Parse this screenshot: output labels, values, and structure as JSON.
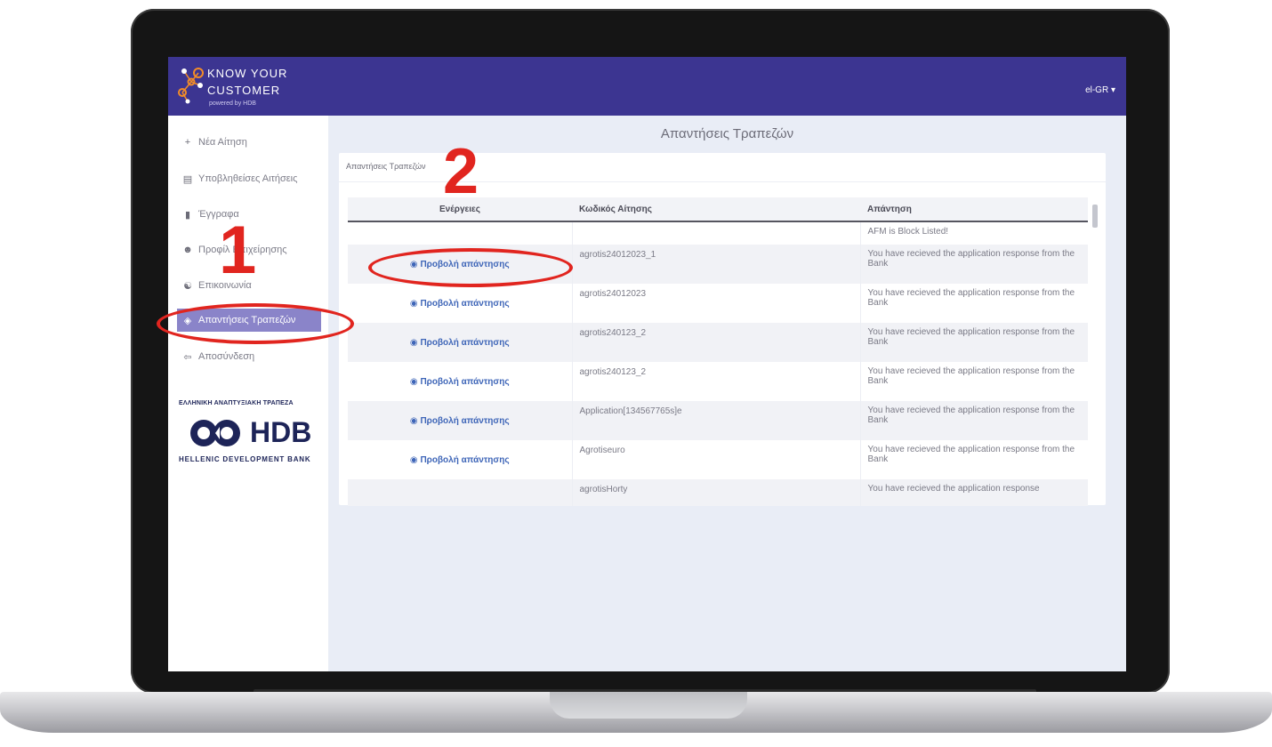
{
  "app": {
    "brand_line1": "KNOW YOUR",
    "brand_line2": "CUSTOMER",
    "brand_sub": "powered by HDB",
    "language": "el-GR",
    "language_icon": "chevron-down-icon"
  },
  "sidebar": {
    "items": [
      {
        "label": "Νέα Αίτηση",
        "icon": "add-user-icon"
      },
      {
        "label": "Υποβληθείσες Αιτήσεις",
        "icon": "document-list-icon"
      },
      {
        "label": "Έγγραφα",
        "icon": "file-icon"
      },
      {
        "label": "Προφίλ Επιχείρησης",
        "icon": "person-icon"
      },
      {
        "label": "Επικοινωνία",
        "icon": "people-icon"
      },
      {
        "label": "Απαντήσεις Τραπεζών",
        "icon": "bell-icon",
        "active": true
      },
      {
        "label": "Αποσύνδεση",
        "icon": "logout-icon"
      }
    ],
    "bank_logo": {
      "greek_name": "ΕΛΛΗΝΙΚΗ ΑΝΑΠΤΥΞΙΑΚΗ ΤΡΑΠΕΖΑ",
      "wordmark": "HDB",
      "english_name": "HELLENIC DEVELOPMENT BANK"
    }
  },
  "main": {
    "title": "Απαντήσεις Τραπεζών",
    "breadcrumb": "Απαντήσεις Τραπεζών",
    "table": {
      "headers": [
        "Ενέργειες",
        "Κωδικός Αίτησης",
        "Απάντηση"
      ],
      "rows": [
        {
          "action": "",
          "code": "",
          "response": "AFM is Block Listed!"
        },
        {
          "action": "Προβολή απάντησης",
          "code": "agrotis24012023_1",
          "response": "You have recieved the application response from the Bank"
        },
        {
          "action": "Προβολή απάντησης",
          "code": "agrotis24012023",
          "response": "You have recieved the application response from the Bank"
        },
        {
          "action": "Προβολή απάντησης",
          "code": "agrotis240123_2",
          "response": "You have recieved the application response from the Bank"
        },
        {
          "action": "Προβολή απάντησης",
          "code": "agrotis240123_2",
          "response": "You have recieved the application response from the Bank"
        },
        {
          "action": "Προβολή απάντησης",
          "code": "Application[134567765s]e",
          "response": "You have recieved the application response from the Bank"
        },
        {
          "action": "Προβολή απάντησης",
          "code": "Agrotiseuro",
          "response": "You have recieved the application response from the Bank"
        },
        {
          "action": "",
          "code": "agrotisHorty",
          "response": "You have recieved the application response"
        }
      ]
    }
  },
  "annotations": {
    "step1": "1",
    "step2": "2",
    "color": "#e1251f"
  },
  "colors": {
    "topbar": "#3c3591",
    "active_item": "#8a84c9",
    "link": "#3f66b8"
  }
}
